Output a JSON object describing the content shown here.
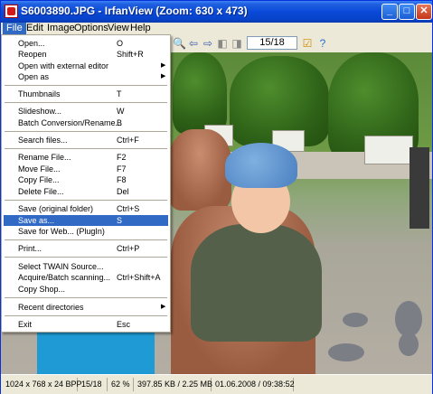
{
  "window": {
    "title": "S6003890.JPG - IrfanView (Zoom: 630 x 473)"
  },
  "menubar": [
    "File",
    "Edit",
    "Image",
    "Options",
    "View",
    "Help"
  ],
  "toolbar": {
    "page": "15/18"
  },
  "file_menu": [
    {
      "label": "Open...",
      "shortcut": "O"
    },
    {
      "label": "Reopen",
      "shortcut": "Shift+R"
    },
    {
      "label": "Open with external editor",
      "shortcut": ""
    },
    {
      "label": "Open as",
      "shortcut": ""
    },
    {
      "label": "Thumbnails",
      "shortcut": "T"
    },
    {
      "label": "Slideshow...",
      "shortcut": "W"
    },
    {
      "label": "Batch Conversion/Rename...",
      "shortcut": "B"
    },
    {
      "label": "Search files...",
      "shortcut": "Ctrl+F"
    },
    {
      "label": "Rename File...",
      "shortcut": "F2"
    },
    {
      "label": "Move File...",
      "shortcut": "F7"
    },
    {
      "label": "Copy File...",
      "shortcut": "F8"
    },
    {
      "label": "Delete File...",
      "shortcut": "Del"
    },
    {
      "label": "Save (original folder)",
      "shortcut": "Ctrl+S"
    },
    {
      "label": "Save as...",
      "shortcut": "S"
    },
    {
      "label": "Save for Web... (PlugIn)",
      "shortcut": ""
    },
    {
      "label": "Print...",
      "shortcut": "Ctrl+P"
    },
    {
      "label": "Select TWAIN Source...",
      "shortcut": ""
    },
    {
      "label": "Acquire/Batch scanning...",
      "shortcut": "Ctrl+Shift+A"
    },
    {
      "label": "Copy Shop...",
      "shortcut": ""
    },
    {
      "label": "Recent directories",
      "shortcut": ""
    },
    {
      "label": "Exit",
      "shortcut": "Esc"
    }
  ],
  "statusbar": {
    "dimensions": "1024 x 768 x 24 BPP",
    "index": "15/18",
    "zoom": "62 %",
    "size": "397.85 KB / 2.25 MB",
    "datetime": "01.06.2008 / 09:38:52"
  },
  "colors": {
    "titlebar": "#0a4ad9",
    "highlight": "#316ac5",
    "face": "#ece9d8"
  }
}
